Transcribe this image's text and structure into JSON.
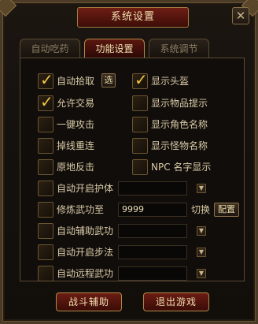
{
  "window": {
    "title": "系统设置",
    "close_glyph": "✕"
  },
  "tabs": [
    {
      "label": "自动吃药",
      "active": false
    },
    {
      "label": "功能设置",
      "active": true
    },
    {
      "label": "系统调节",
      "active": false
    }
  ],
  "left_options": [
    {
      "label": "自动拾取",
      "checked": true
    },
    {
      "label": "允许交易",
      "checked": true
    },
    {
      "label": "一键攻击",
      "checked": false
    },
    {
      "label": "掉线重连",
      "checked": false
    },
    {
      "label": "原地反击",
      "checked": false
    }
  ],
  "pickup_button": "选",
  "right_options": [
    {
      "label": "显示头盔",
      "checked": true
    },
    {
      "label": "显示物品提示",
      "checked": false
    },
    {
      "label": "显示角色名称",
      "checked": false
    },
    {
      "label": "显示怪物名称",
      "checked": false
    },
    {
      "label": "NPC 名字显示",
      "checked": false
    }
  ],
  "wide_options": [
    {
      "label": "自动开启护体",
      "checked": false,
      "value": ""
    },
    {
      "label": "修炼武功至",
      "checked": false,
      "value": "9999"
    },
    {
      "label": "自动辅助武功",
      "checked": false,
      "value": ""
    },
    {
      "label": "自动开启步法",
      "checked": false,
      "value": ""
    },
    {
      "label": "自动远程武功",
      "checked": false,
      "value": ""
    }
  ],
  "switch_label": "切换",
  "config_button": "配置",
  "bottom": {
    "battle_assist": "战斗辅助",
    "exit_game": "退出游戏"
  },
  "icons": {
    "check": "check-icon",
    "dropdown": "chevron-down-icon",
    "close": "close-icon"
  },
  "colors": {
    "accent": "#f5c542",
    "tab_active": "#5a170f",
    "text": "#d9cba8"
  }
}
